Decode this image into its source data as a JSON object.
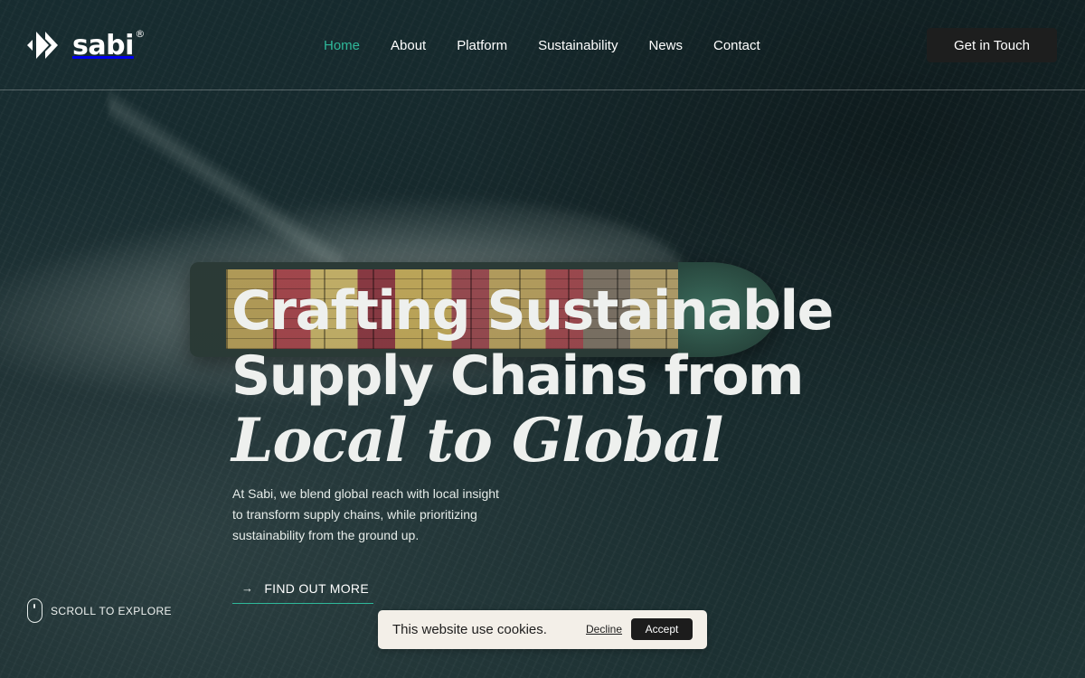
{
  "brand": {
    "name": "sabi",
    "registered_mark": "®",
    "logo_icon": "double-chevron-icon"
  },
  "nav": {
    "items": [
      {
        "label": "Home",
        "active": true
      },
      {
        "label": "About",
        "active": false
      },
      {
        "label": "Platform",
        "active": false
      },
      {
        "label": "Sustainability",
        "active": false
      },
      {
        "label": "News",
        "active": false
      },
      {
        "label": "Contact",
        "active": false
      }
    ],
    "active_color": "#2fb89a"
  },
  "header": {
    "cta_label": "Get in Touch"
  },
  "hero": {
    "headline_line1": "Crafting Sustainable",
    "headline_line2": "Supply Chains from",
    "headline_line3": "Local to Global",
    "description": "At Sabi, we blend global reach with local insight to transform supply chains, while prioritizing sustainability from the ground up.",
    "cta_label": "FIND OUT MORE",
    "cta_icon": "arrow-right-icon",
    "background_image": "container-ship-aerial",
    "accent_color": "#2fb89a"
  },
  "scroll_hint": {
    "label": "SCROLL TO EXPLORE",
    "icon": "mouse-icon"
  },
  "cookie_banner": {
    "message": "This website use cookies.",
    "decline_label": "Decline",
    "accept_label": "Accept"
  }
}
